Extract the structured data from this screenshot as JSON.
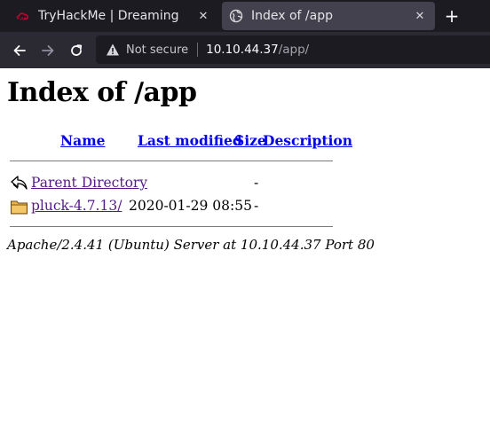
{
  "browser": {
    "tabs": [
      {
        "title": "TryHackMe | Dreaming",
        "favicon": "tryhackme-icon",
        "active": false
      },
      {
        "title": "Index of /app",
        "favicon": "globe-icon",
        "active": true
      }
    ],
    "new_tab_label": "+",
    "url": {
      "security_label": "Not secure",
      "host": "10.10.44.37",
      "path": "/app/"
    }
  },
  "page": {
    "heading": "Index of /app",
    "columns": {
      "name": "Name",
      "last_modified": "Last modified",
      "size": "Size",
      "description": "Description"
    },
    "rows": [
      {
        "icon": "back-arrow-icon",
        "name": "Parent Directory",
        "last_modified": "",
        "size": "-",
        "description": ""
      },
      {
        "icon": "folder-icon",
        "name": "pluck-4.7.13/",
        "last_modified": "2020-01-29 08:55",
        "size": "-",
        "description": ""
      }
    ],
    "footer": "Apache/2.4.41 (Ubuntu) Server at 10.10.44.37 Port 80"
  },
  "colors": {
    "tab_strip": "#1c1b22",
    "active_tab": "#42414d",
    "link": "#0000ee",
    "visited_link": "#551a8b"
  }
}
